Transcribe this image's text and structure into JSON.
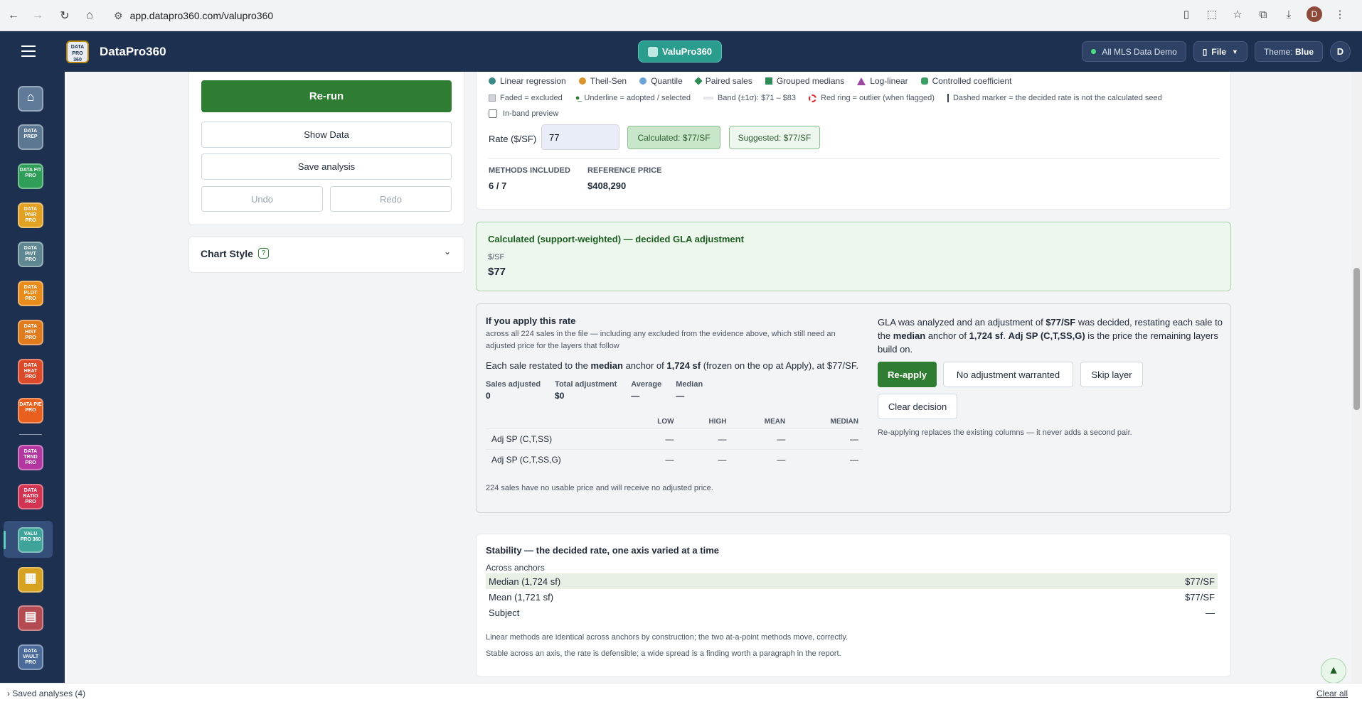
{
  "browser": {
    "url": "app.datapro360.com/valupro360",
    "profile": "D"
  },
  "app": {
    "brand": "DataPro360",
    "center_pill": "ValuPro360",
    "mls_pill": "All MLS Data Demo",
    "file_btn": "File",
    "theme_label": "Theme:",
    "theme_value": "Blue",
    "avatar": "D",
    "logo_text": "DATA PRO 360"
  },
  "nav": [
    {
      "name": "home",
      "text": "⌂",
      "color": "#607a99"
    },
    {
      "name": "data-prep",
      "text": "DATA PREP",
      "color": "#5c7791"
    },
    {
      "name": "data-fit-pro",
      "text": "DATA FIT PRO",
      "color": "#2e9e58"
    },
    {
      "name": "data-pair-pro",
      "text": "DATA PAIR PRO",
      "color": "#e2a123"
    },
    {
      "name": "data-pivt-pro",
      "text": "DATA PIVT PRO",
      "color": "#5f8791"
    },
    {
      "name": "data-plot-pro",
      "text": "DATA PLOT PRO",
      "color": "#e88c1c"
    },
    {
      "name": "data-hist-pro",
      "text": "DATA HIST PRO",
      "color": "#e07b1e"
    },
    {
      "name": "data-heat-pro",
      "text": "DATA HEAT PRO",
      "color": "#dd4a2a"
    },
    {
      "name": "data-pie-pro",
      "text": "DATA PIE PRO",
      "color": "#e9601e"
    },
    {
      "name": "data-trnd-pro",
      "text": "DATA TRND PRO",
      "color": "#b237a0"
    },
    {
      "name": "data-ratio-pro",
      "text": "DATA RATIO PRO",
      "color": "#d33452"
    },
    {
      "name": "valu-pro-360",
      "text": "VALU PRO 360",
      "color": "#3ea398"
    },
    {
      "name": "tables-app",
      "text": "▦",
      "color": "#d6a21f"
    },
    {
      "name": "reports-app",
      "text": "▤",
      "color": "#b44b52"
    },
    {
      "name": "data-vault-pro",
      "text": "DATA VAULT PRO",
      "color": "#4a6a9a"
    }
  ],
  "left": {
    "rerun": "Re-run",
    "show_data": "Show Data",
    "save_analysis": "Save analysis",
    "undo": "Undo",
    "redo": "Redo",
    "chart_style": "Chart Style",
    "help": "?"
  },
  "legend": {
    "items": [
      {
        "label": "Linear regression",
        "color": "#3a8a8a",
        "shape": "dot"
      },
      {
        "label": "Theil-Sen",
        "color": "#d9952b",
        "shape": "dot"
      },
      {
        "label": "Quantile",
        "color": "#6aa3d8",
        "shape": "dot"
      },
      {
        "label": "Paired sales",
        "color": "#2e8b57",
        "shape": "diamond"
      },
      {
        "label": "Grouped medians",
        "color": "#2e8b57",
        "shape": "square"
      },
      {
        "label": "Log-linear",
        "color": "#9b4aa0",
        "shape": "triangle"
      },
      {
        "label": "Controlled coefficient",
        "color": "#3aa063",
        "shape": "hex"
      }
    ],
    "keys": [
      "Faded = excluded",
      "Underline = adopted / selected",
      "Band (±1σ): $71 – $83",
      "Red ring = outlier (when flagged)",
      "Dashed marker = the decided rate is not the calculated seed"
    ],
    "in_band": "In-band preview"
  },
  "rate": {
    "label": "Rate ($/SF)",
    "value": "77",
    "calculated": "Calculated: $77/SF",
    "suggested": "Suggested: $77/SF"
  },
  "summary": {
    "methods_label": "METHODS INCLUDED",
    "methods_value": "6 / 7",
    "ref_label": "REFERENCE PRICE",
    "ref_value": "$408,290"
  },
  "decided": {
    "title": "Calculated (support-weighted) — decided GLA adjustment",
    "unit": "$/SF",
    "value": "$77"
  },
  "apply": {
    "title": "If you apply this rate",
    "sub": "across all 224 sales in the file — including any excluded from the evidence above, which still need an adjusted price for the layers that follow",
    "restate_a": "Each sale restated to the ",
    "restate_b": "median",
    "restate_c": " anchor of ",
    "restate_d": "1,724 sf",
    "restate_e": " (frozen on the op at Apply), at $77/SF.",
    "stats": [
      {
        "label": "Sales adjusted",
        "value": "0"
      },
      {
        "label": "Total adjustment",
        "value": "$0"
      },
      {
        "label": "Average",
        "value": "—"
      },
      {
        "label": "Median",
        "value": "—"
      }
    ],
    "table_head": [
      "LOW",
      "HIGH",
      "MEAN",
      "MEDIAN"
    ],
    "table_rows": [
      {
        "label": "Adj SP (C,T,SS)",
        "cells": [
          "—",
          "—",
          "—",
          "—"
        ]
      },
      {
        "label": "Adj SP (C,T,SS,G)",
        "cells": [
          "—",
          "—",
          "—",
          "—"
        ]
      }
    ],
    "note": "224 sales have no usable price and will receive no adjusted price.",
    "right_a": "GLA was analyzed and an adjustment of ",
    "right_b": "$77/SF",
    "right_c": " was decided, restating each sale to the ",
    "right_d": "median",
    "right_e": " anchor of ",
    "right_f": "1,724 sf",
    "right_g": ". ",
    "right_h": "Adj SP (C,T,SS,G)",
    "right_i": " is the price the remaining layers build on.",
    "reapply": "Re-apply",
    "no_adj": "No adjustment warranted",
    "skip": "Skip layer",
    "clear": "Clear decision",
    "replace_note": "Re-applying replaces the existing columns — it never adds a second pair."
  },
  "stability": {
    "title": "Stability — the decided rate, one axis varied at a time",
    "section": "Across anchors",
    "rows": [
      {
        "label": "Median (1,724 sf)",
        "value": "$77/SF"
      },
      {
        "label": "Mean (1,721 sf)",
        "value": "$77/SF"
      },
      {
        "label": "Subject",
        "value": "—"
      }
    ],
    "note1": "Linear methods are identical across anchors by construction; the two at-a-point methods move, correctly.",
    "note2": "Stable across an axis, the rate is defensible; a wide spread is a finding worth a paragraph in the report."
  },
  "bottom": {
    "saved": "Saved analyses (4)",
    "clear_all": "Clear all"
  }
}
